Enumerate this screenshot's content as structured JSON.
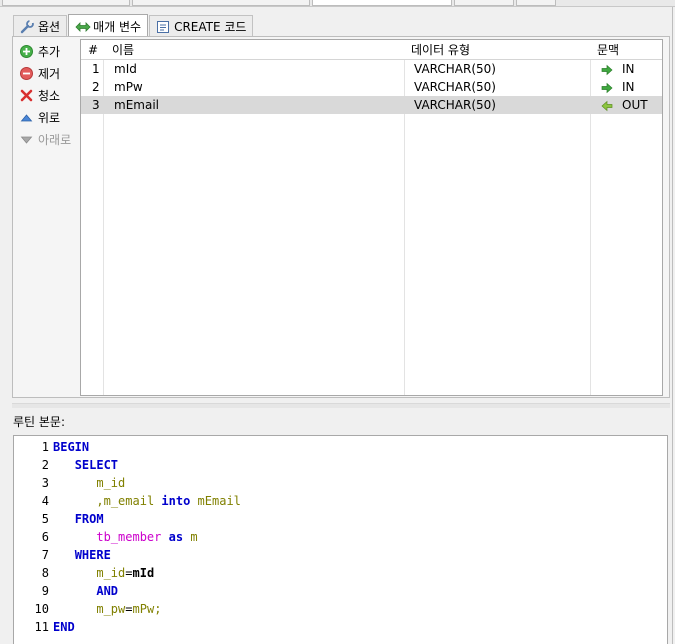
{
  "tabs": [
    {
      "label": "옵션",
      "icon": "wrench-icon"
    },
    {
      "label": "매개 변수",
      "icon": "double-arrow-icon"
    },
    {
      "label": "CREATE 코드",
      "icon": "code-document-icon"
    }
  ],
  "side_buttons": [
    {
      "label": "추가",
      "icon": "add-circle-icon",
      "color": "#3aa53a",
      "enabled": true
    },
    {
      "label": "제거",
      "icon": "remove-circle-icon",
      "color": "#e05050",
      "enabled": true
    },
    {
      "label": "청소",
      "icon": "clear-x-icon",
      "color": "#d33",
      "enabled": true
    },
    {
      "label": "위로",
      "icon": "arrow-up-icon",
      "color": "#3a78d0",
      "enabled": true
    },
    {
      "label": "아래로",
      "icon": "arrow-down-icon",
      "color": "#999999",
      "enabled": false
    }
  ],
  "table": {
    "headers": [
      "#",
      "이름",
      "데이터 유형",
      "문맥"
    ],
    "rows": [
      {
        "num": "1",
        "name": "mId",
        "type": "VARCHAR(50)",
        "context": "IN",
        "dir": "in"
      },
      {
        "num": "2",
        "name": "mPw",
        "type": "VARCHAR(50)",
        "context": "IN",
        "dir": "in"
      },
      {
        "num": "3",
        "name": "mEmail",
        "type": "VARCHAR(50)",
        "context": "OUT",
        "dir": "out",
        "selected": true
      }
    ]
  },
  "routine_label": "루틴 본문:",
  "code_lines": [
    {
      "n": "1",
      "tokens": [
        [
          "kw",
          "BEGIN"
        ]
      ]
    },
    {
      "n": "2",
      "tokens": [
        [
          "op",
          "   "
        ],
        [
          "kw",
          "SELECT"
        ]
      ]
    },
    {
      "n": "3",
      "tokens": [
        [
          "op",
          "      "
        ],
        [
          "id",
          "m_id"
        ]
      ]
    },
    {
      "n": "4",
      "tokens": [
        [
          "op",
          "      "
        ],
        [
          "punc",
          ","
        ],
        [
          "id",
          "m_email"
        ],
        [
          "op",
          " "
        ],
        [
          "kw",
          "into"
        ],
        [
          "op",
          " "
        ],
        [
          "id",
          "mEmail"
        ]
      ]
    },
    {
      "n": "5",
      "tokens": [
        [
          "op",
          "   "
        ],
        [
          "kw",
          "FROM"
        ]
      ]
    },
    {
      "n": "6",
      "tokens": [
        [
          "op",
          "      "
        ],
        [
          "tb",
          "tb_member"
        ],
        [
          "op",
          " "
        ],
        [
          "kw",
          "as"
        ],
        [
          "op",
          " "
        ],
        [
          "id",
          "m"
        ]
      ]
    },
    {
      "n": "7",
      "tokens": [
        [
          "op",
          "   "
        ],
        [
          "kw",
          "WHERE"
        ]
      ]
    },
    {
      "n": "8",
      "tokens": [
        [
          "op",
          "      "
        ],
        [
          "id",
          "m_id"
        ],
        [
          "op",
          "="
        ],
        [
          "op",
          "mId"
        ]
      ]
    },
    {
      "n": "9",
      "tokens": [
        [
          "op",
          "      "
        ],
        [
          "kw",
          "AND"
        ]
      ]
    },
    {
      "n": "10",
      "tokens": [
        [
          "op",
          "      "
        ],
        [
          "id",
          "m_pw"
        ],
        [
          "op",
          "="
        ],
        [
          "id",
          "mPw"
        ],
        [
          "punc",
          ";"
        ]
      ]
    },
    {
      "n": "11",
      "tokens": [
        [
          "kw",
          "END"
        ]
      ]
    }
  ],
  "colors": {
    "keyword": "#0000cc",
    "identifier": "#808000",
    "table_name": "#cc00cc",
    "selected_row": "#d9d9d9",
    "in_arrow": "#3aa53a",
    "out_arrow": "#8bbf3a"
  }
}
